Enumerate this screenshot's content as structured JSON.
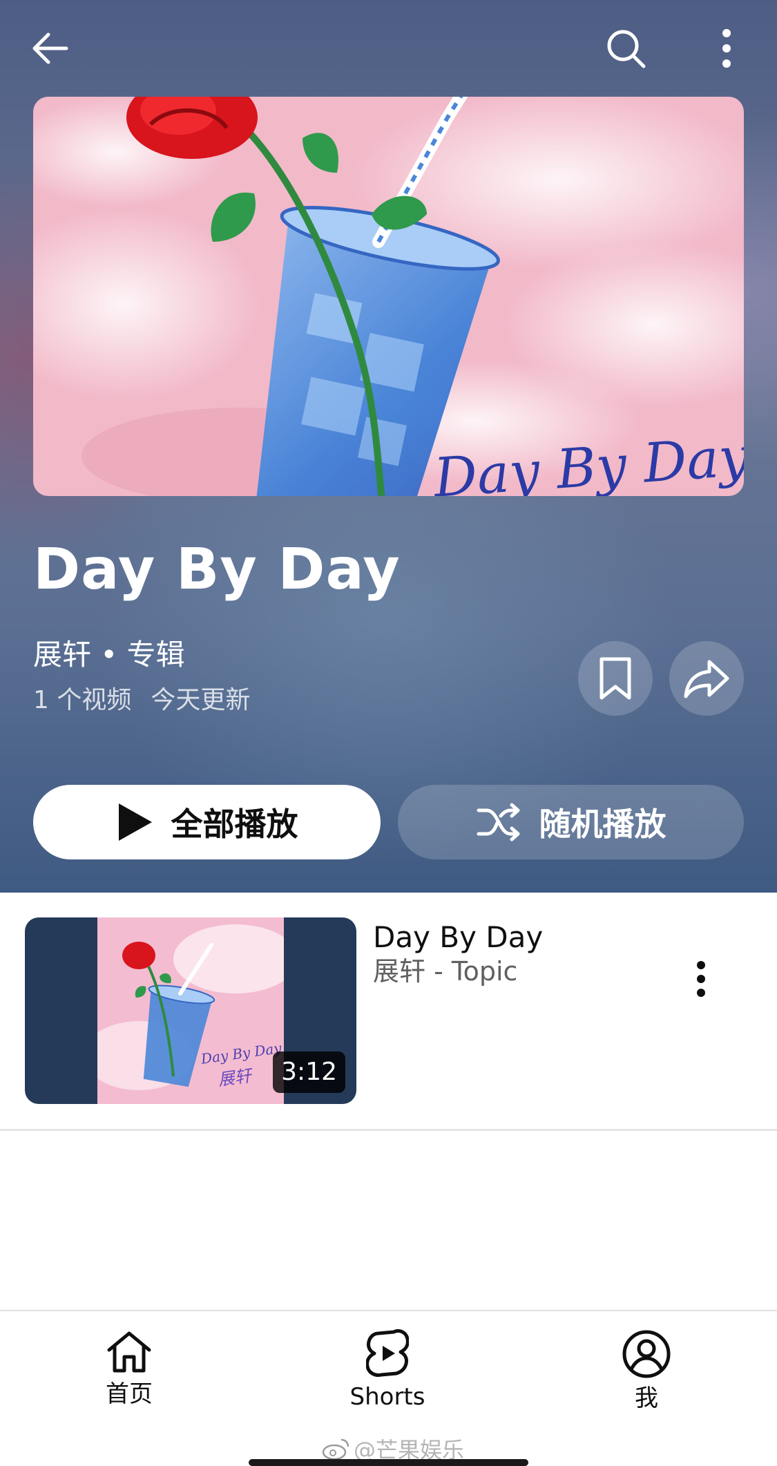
{
  "header": {
    "back_icon": "arrow-left-icon",
    "search_icon": "search-icon",
    "more_icon": "more-vert-icon"
  },
  "cover": {
    "art_text": "Day By Day"
  },
  "playlist": {
    "title": "Day By Day",
    "artist": "展轩",
    "separator": " • ",
    "type": "专辑",
    "video_count": "1 个视频",
    "updated": "今天更新",
    "save_icon": "bookmark-icon",
    "share_icon": "share-icon"
  },
  "actions": {
    "play_all_label": "全部播放",
    "shuffle_label": "随机播放"
  },
  "videos": [
    {
      "title": "Day By Day",
      "channel": "展轩 - Topic",
      "duration": "3:12",
      "thumb_text_1": "Day By Day",
      "thumb_text_2": "展轩"
    }
  ],
  "bottom_nav": {
    "home_label": "首页",
    "shorts_label": "Shorts",
    "me_label": "我"
  },
  "watermark": "@芒果娱乐",
  "colors": {
    "header_bg": "#5b6f93",
    "play_all_bg": "#ffffff",
    "thumb_bg": "#243a58"
  }
}
